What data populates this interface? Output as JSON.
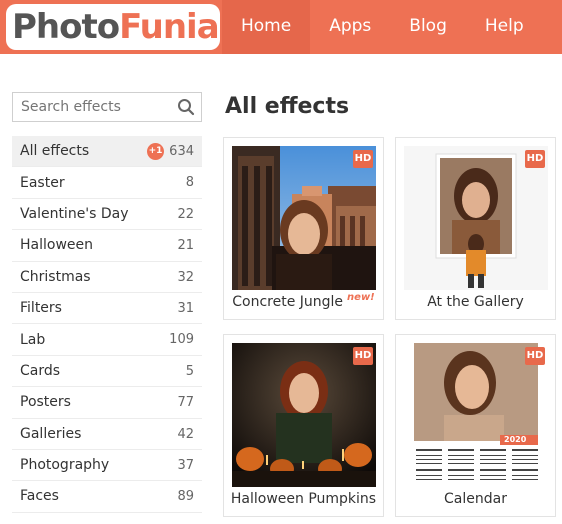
{
  "brand": {
    "logo_part1": "Photo",
    "logo_part2": "Funia"
  },
  "nav": {
    "items": [
      {
        "label": "Home"
      },
      {
        "label": "Apps"
      },
      {
        "label": "Blog"
      },
      {
        "label": "Help"
      }
    ]
  },
  "search": {
    "placeholder": "Search effects"
  },
  "sidebar": {
    "items": [
      {
        "label": "All effects",
        "count": "634",
        "badge": "+1"
      },
      {
        "label": "Easter",
        "count": "8"
      },
      {
        "label": "Valentine's Day",
        "count": "22"
      },
      {
        "label": "Halloween",
        "count": "21"
      },
      {
        "label": "Christmas",
        "count": "32"
      },
      {
        "label": "Filters",
        "count": "31"
      },
      {
        "label": "Lab",
        "count": "109"
      },
      {
        "label": "Cards",
        "count": "5"
      },
      {
        "label": "Posters",
        "count": "77"
      },
      {
        "label": "Galleries",
        "count": "42"
      },
      {
        "label": "Photography",
        "count": "37"
      },
      {
        "label": "Faces",
        "count": "89"
      }
    ]
  },
  "main": {
    "title": "All effects"
  },
  "effects": [
    {
      "title": "Concrete Jungle",
      "hd": "HD",
      "new_tag": "new!"
    },
    {
      "title": "At the Gallery",
      "hd": "HD"
    },
    {
      "title": "Halloween Pumpkins",
      "hd": "HD"
    },
    {
      "title": "Calendar",
      "hd": "HD",
      "year": "2020"
    }
  ],
  "colors": {
    "brand": "#ee7154",
    "nav_active": "#e5674b"
  }
}
